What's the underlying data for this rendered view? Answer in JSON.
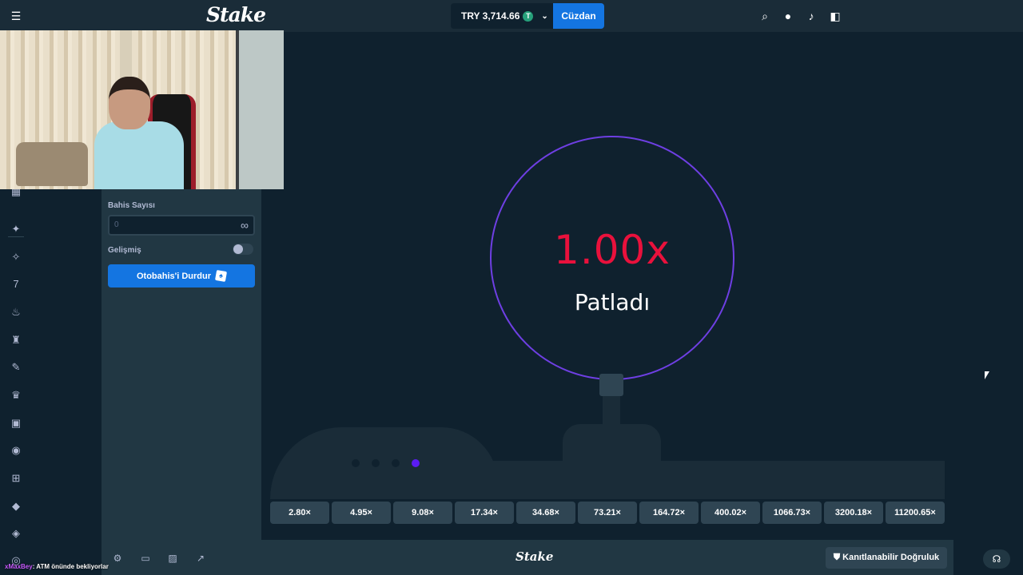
{
  "topbar": {
    "logo": "Stake",
    "balance_text": "TRY 3,714.66",
    "coin_symbol": "T",
    "wallet_label": "Cüzdan",
    "icons": [
      "menu-icon",
      "search-icon",
      "user-icon",
      "bell-icon",
      "sidebar-toggle-icon"
    ]
  },
  "sidebar": {
    "icons": [
      "slots-icon",
      "new-releases-icon",
      "stake-originals-icon",
      "hot-icon",
      "live-casino-icon",
      "sports-icon",
      "trophy-icon",
      "bet-slip-icon",
      "poker-icon",
      "gift-icon",
      "cards-icon",
      "tickets-icon",
      "help-icon"
    ]
  },
  "panel": {
    "bet_count_label": "Bahis Sayısı",
    "bet_count_value": "0",
    "infinity_symbol": "∞",
    "advanced_label": "Gelişmiş",
    "advanced_enabled": false,
    "stop_button_label": "Otobahis'i Durdur"
  },
  "game": {
    "multiplier": "1.00x",
    "status": "Patladı",
    "multiplier_color": "#e9113c",
    "bubble_color": "#6e3fe3",
    "active_dot_color": "#5b1cf2",
    "history": [
      "2.80×",
      "4.95×",
      "9.08×",
      "17.34×",
      "34.68×",
      "73.21×",
      "164.72×",
      "400.02×",
      "1066.73×",
      "3200.18×",
      "11200.65×"
    ]
  },
  "bottombar": {
    "logo": "Stake",
    "fairness_label": "Kanıtlanabilir Doğruluk",
    "icons": [
      "settings-icon",
      "theatre-mode-icon",
      "stats-icon",
      "popout-icon"
    ]
  },
  "chat": {
    "user": "xMaxBey",
    "message": ": ATM önünde bekliyorlar"
  }
}
